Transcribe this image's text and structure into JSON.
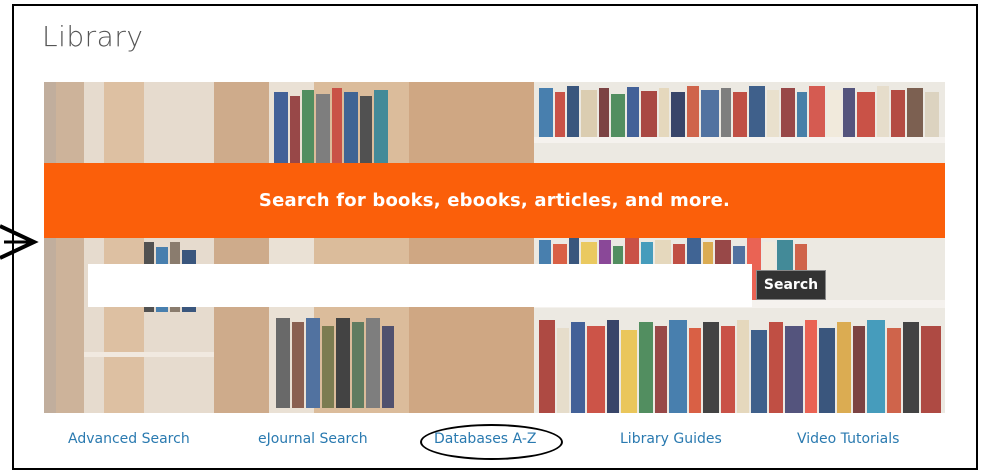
{
  "page": {
    "title": "Library"
  },
  "hero": {
    "banner_text": "Search for books, ebooks, articles, and more.",
    "search": {
      "value": "",
      "placeholder": "",
      "button_label": "Search"
    }
  },
  "links": [
    {
      "label": "Advanced Search"
    },
    {
      "label": "eJournal Search"
    },
    {
      "label": "Databases A-Z"
    },
    {
      "label": "Library Guides"
    },
    {
      "label": "Video Tutorials"
    }
  ],
  "colors": {
    "banner": "#fb5f0a",
    "link": "#2a7ab0",
    "search_button": "#333333",
    "title": "#555555"
  },
  "annotations": {
    "highlighted_link": "Databases A-Z",
    "arrow_target": "search-input"
  }
}
